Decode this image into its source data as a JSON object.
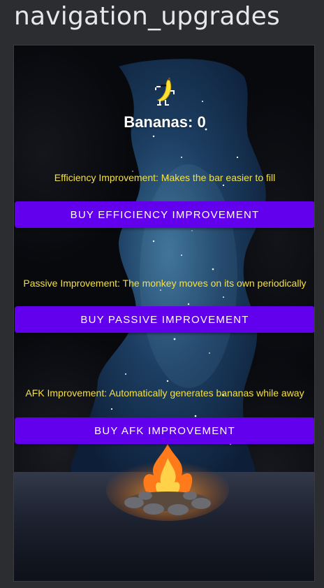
{
  "page": {
    "title": "navigation_upgrades"
  },
  "app": {
    "bananas_label": "Bananas: 0",
    "upgrades": [
      {
        "description": "Efficiency Improvement: Makes the bar easier to fill",
        "button_label": "BUY EFFICIENCY IMPROVEMENT"
      },
      {
        "description": "Passive Improvement: The monkey moves on its own periodically",
        "button_label": "BUY PASSIVE IMPROVEMENT"
      },
      {
        "description": "AFK Improvement: Automatically generates bananas while away",
        "button_label": "BUY AFK IMPROVEMENT"
      }
    ]
  },
  "icons": {
    "mascot": "dancing-banana-icon"
  },
  "colors": {
    "page_background": "#2b2d30",
    "page_title_text": "#e8e8ea",
    "button_background": "#6200ee",
    "button_text": "#ffffff",
    "description_text": "#f5e043",
    "counter_text": "#ffffff"
  }
}
